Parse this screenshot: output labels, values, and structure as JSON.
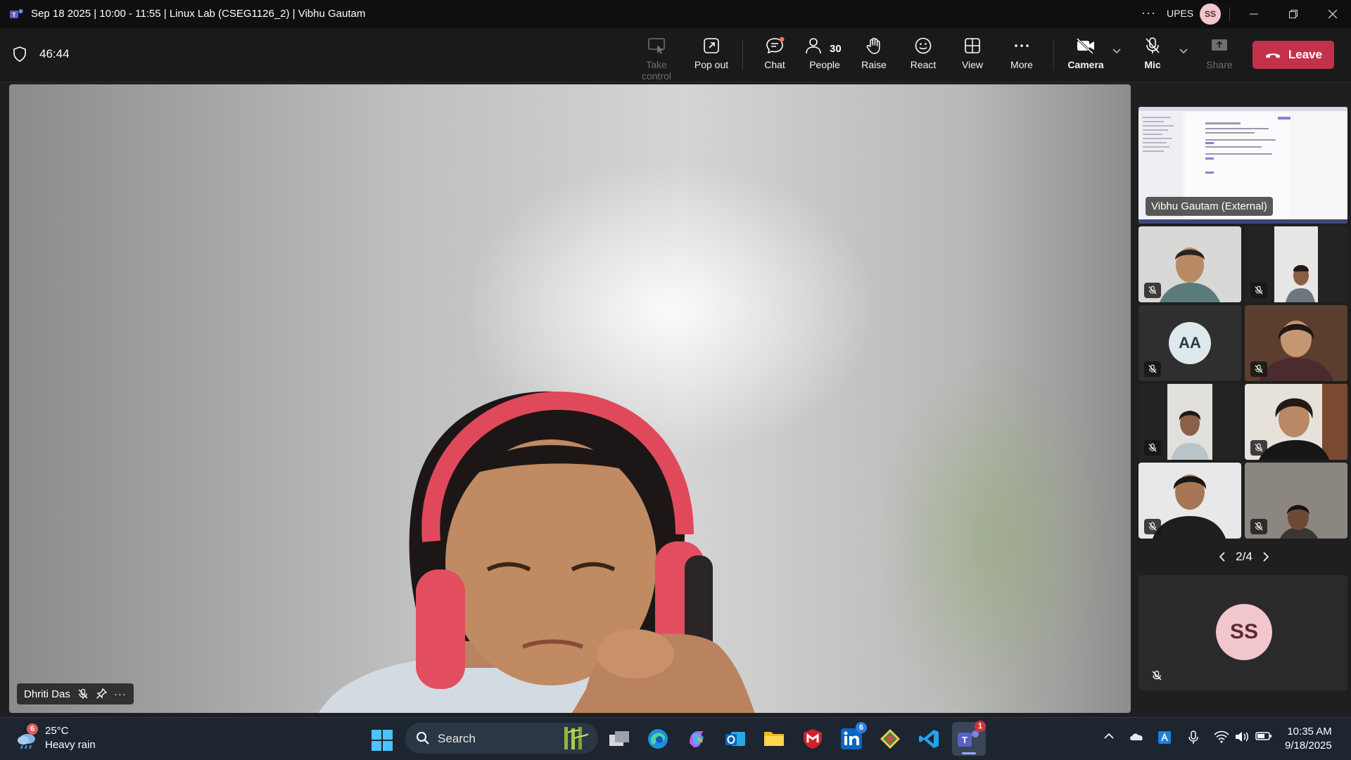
{
  "titlebar": {
    "title": "Sep 18 2025 | 10:00 - 11:55 | Linux Lab (CSEG1126_2) | Vibhu Gautam",
    "org": "UPES",
    "user_initials": "SS",
    "more_icon": "ellipsis-icon"
  },
  "toolbar": {
    "timer": "46:44",
    "take_control": "Take control",
    "pop_out": "Pop out",
    "chat": "Chat",
    "people": "People",
    "people_count": "30",
    "raise": "Raise",
    "react": "React",
    "view": "View",
    "more": "More",
    "camera": "Camera",
    "mic": "Mic",
    "share": "Share",
    "leave": "Leave",
    "leave_color": "#c4314b"
  },
  "stage": {
    "participant_name": "Dhriti Das"
  },
  "gallery": {
    "share_label": "Vibhu Gautam (External)",
    "tile_aa_initials": "AA",
    "page": "2/4",
    "self_initials": "SS"
  },
  "taskbar": {
    "weather_badge": "6",
    "temperature": "25°C",
    "weather": "Heavy rain",
    "search": "Search",
    "linkedin_badge": "6",
    "teams_badge": "1",
    "time": "10:35 AM",
    "date": "9/18/2025"
  }
}
